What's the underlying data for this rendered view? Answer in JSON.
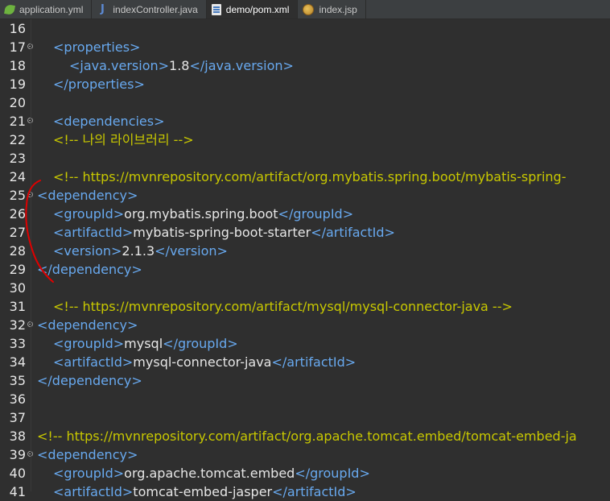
{
  "tabs": [
    {
      "label": "application.yml",
      "icon": "spring-leaf-icon",
      "active": false
    },
    {
      "label": "indexController.java",
      "icon": "java-file-icon",
      "active": false
    },
    {
      "label": "demo/pom.xml",
      "icon": "xml-file-icon",
      "active": true
    },
    {
      "label": "index.jsp",
      "icon": "jsp-globe-icon",
      "active": false
    }
  ],
  "colors": {
    "tag": "#68a9ef",
    "text": "#e6e6e6",
    "comment": "#c8c800",
    "background": "#2f2f2f",
    "annotation": "#e00000"
  },
  "lines": [
    {
      "num": "16",
      "fold": false,
      "parts": []
    },
    {
      "num": "17",
      "fold": true,
      "parts": [
        {
          "t": "tag",
          "v": "<properties>"
        }
      ]
    },
    {
      "num": "18",
      "fold": false,
      "parts": [
        {
          "t": "tag",
          "v": "<java.version>"
        },
        {
          "t": "txt",
          "v": "1.8"
        },
        {
          "t": "tag",
          "v": "</java.version>"
        }
      ]
    },
    {
      "num": "19",
      "fold": false,
      "parts": [
        {
          "t": "tag",
          "v": "</properties>"
        }
      ]
    },
    {
      "num": "20",
      "fold": false,
      "parts": []
    },
    {
      "num": "21",
      "fold": true,
      "parts": [
        {
          "t": "tag",
          "v": "<dependencies>"
        }
      ]
    },
    {
      "num": "22",
      "fold": false,
      "parts": [
        {
          "t": "cmt",
          "v": "<!-- 나의 라이브러리 -->"
        }
      ]
    },
    {
      "num": "23",
      "fold": false,
      "parts": []
    },
    {
      "num": "24",
      "fold": false,
      "parts": [
        {
          "t": "cmt",
          "v": "<!-- https://mvnrepository.com/artifact/org.mybatis.spring.boot/mybatis-spring-"
        }
      ]
    },
    {
      "num": "25",
      "fold": true,
      "parts": [
        {
          "t": "tag",
          "v": "<dependency>"
        }
      ]
    },
    {
      "num": "26",
      "fold": false,
      "parts": [
        {
          "t": "tag",
          "v": "<groupId>"
        },
        {
          "t": "txt",
          "v": "org.mybatis.spring.boot"
        },
        {
          "t": "tag",
          "v": "</groupId>"
        }
      ]
    },
    {
      "num": "27",
      "fold": false,
      "parts": [
        {
          "t": "tag",
          "v": "<artifactId>"
        },
        {
          "t": "txt",
          "v": "mybatis-spring-boot-starter"
        },
        {
          "t": "tag",
          "v": "</artifactId>"
        }
      ]
    },
    {
      "num": "28",
      "fold": false,
      "parts": [
        {
          "t": "tag",
          "v": "<version>"
        },
        {
          "t": "txt",
          "v": "2.1.3"
        },
        {
          "t": "tag",
          "v": "</version>"
        }
      ]
    },
    {
      "num": "29",
      "fold": false,
      "parts": [
        {
          "t": "tag",
          "v": "</dependency>"
        }
      ]
    },
    {
      "num": "30",
      "fold": false,
      "parts": []
    },
    {
      "num": "31",
      "fold": false,
      "parts": [
        {
          "t": "cmt",
          "v": "<!-- https://mvnrepository.com/artifact/mysql/mysql-connector-java -->"
        }
      ]
    },
    {
      "num": "32",
      "fold": true,
      "parts": [
        {
          "t": "tag",
          "v": "<dependency>"
        }
      ]
    },
    {
      "num": "33",
      "fold": false,
      "parts": [
        {
          "t": "tag",
          "v": "<groupId>"
        },
        {
          "t": "txt",
          "v": "mysql"
        },
        {
          "t": "tag",
          "v": "</groupId>"
        }
      ]
    },
    {
      "num": "34",
      "fold": false,
      "parts": [
        {
          "t": "tag",
          "v": "<artifactId>"
        },
        {
          "t": "txt",
          "v": "mysql-connector-java"
        },
        {
          "t": "tag",
          "v": "</artifactId>"
        }
      ]
    },
    {
      "num": "35",
      "fold": false,
      "parts": [
        {
          "t": "tag",
          "v": "</dependency>"
        }
      ]
    },
    {
      "num": "36",
      "fold": false,
      "parts": []
    },
    {
      "num": "37",
      "fold": false,
      "parts": []
    },
    {
      "num": "38",
      "fold": false,
      "parts": [
        {
          "t": "cmt",
          "v": "<!-- https://mvnrepository.com/artifact/org.apache.tomcat.embed/tomcat-embed-ja"
        }
      ]
    },
    {
      "num": "39",
      "fold": true,
      "parts": [
        {
          "t": "tag",
          "v": "<dependency>"
        }
      ]
    },
    {
      "num": "40",
      "fold": false,
      "parts": [
        {
          "t": "tag",
          "v": "<groupId>"
        },
        {
          "t": "txt",
          "v": "org.apache.tomcat.embed"
        },
        {
          "t": "tag",
          "v": "</groupId>"
        }
      ]
    },
    {
      "num": "41",
      "fold": false,
      "parts": [
        {
          "t": "tag",
          "v": "<artifactId>"
        },
        {
          "t": "txt",
          "v": "tomcat-embed-jasper"
        },
        {
          "t": "tag",
          "v": "</artifactId>"
        }
      ]
    }
  ]
}
